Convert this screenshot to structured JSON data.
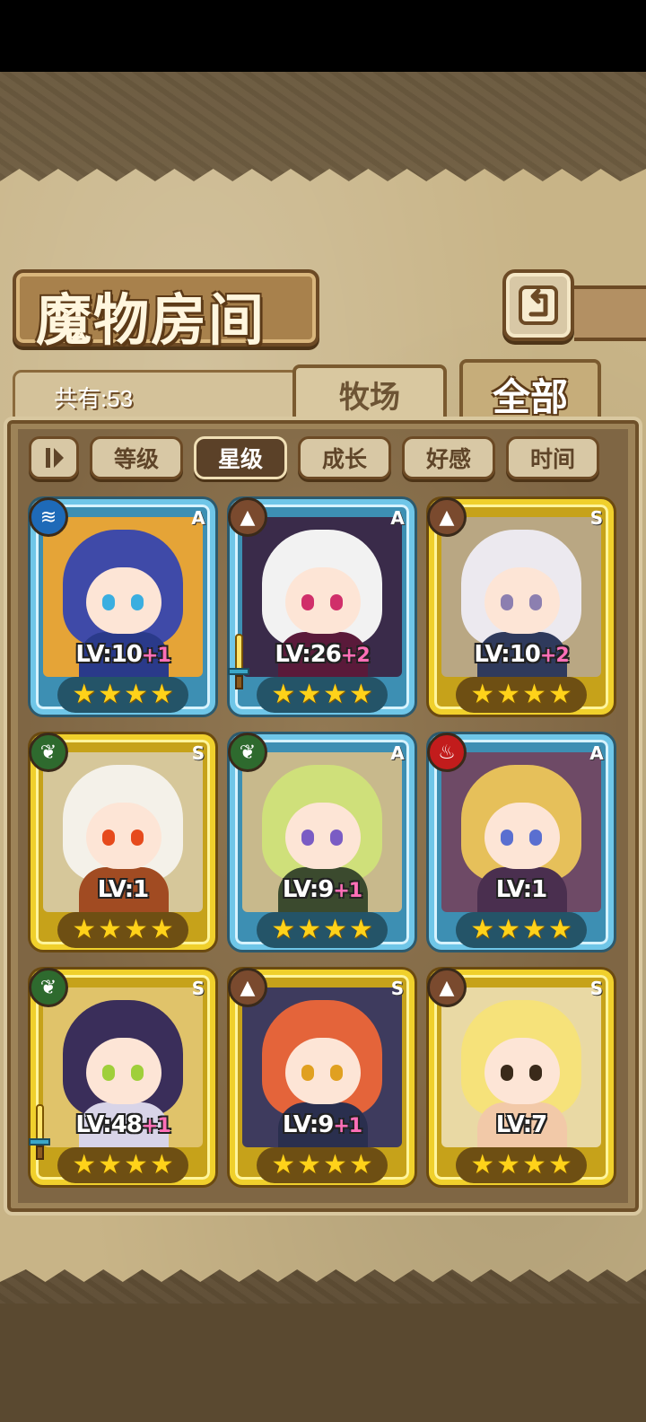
{
  "header": {
    "title": "魔物房间",
    "count_label": "共有:53"
  },
  "tabs": [
    {
      "label": "牧场"
    },
    {
      "label": "全部",
      "active": true
    }
  ],
  "sort_buttons": [
    {
      "label": "等级"
    },
    {
      "label": "星级",
      "active": true
    },
    {
      "label": "成长"
    },
    {
      "label": "好感"
    },
    {
      "label": "时间"
    }
  ],
  "monsters": [
    {
      "rank": "A",
      "element": "water",
      "level": "LV:10",
      "plus": "+1",
      "stars": 4,
      "frame": "blue",
      "weapon": false,
      "hair": "#3f4aa8",
      "body": "#2a3a8a",
      "eye": "#3aaee0",
      "bg": "#e5a437"
    },
    {
      "rank": "A",
      "element": "earth",
      "level": "LV:26",
      "plus": "+2",
      "stars": 4,
      "frame": "blue",
      "weapon": true,
      "hair": "#f2f2f2",
      "body": "#5a1a3a",
      "eye": "#d02f6a",
      "bg": "#3a2b4a"
    },
    {
      "rank": "S",
      "element": "earth",
      "level": "LV:10",
      "plus": "+2",
      "stars": 4,
      "frame": "gold",
      "weapon": false,
      "hair": "#ece9ef",
      "body": "#2f3a5c",
      "eye": "#8c7fb0",
      "bg": "#b9a783"
    },
    {
      "rank": "S",
      "element": "wood",
      "level": "LV:1",
      "plus": "",
      "stars": 4,
      "frame": "gold",
      "weapon": false,
      "hair": "#f4f1e9",
      "body": "#a14b22",
      "eye": "#e64a1c",
      "bg": "#d6c79a"
    },
    {
      "rank": "A",
      "element": "wood",
      "level": "LV:9",
      "plus": "+1",
      "stars": 4,
      "frame": "blue",
      "weapon": false,
      "hair": "#cfe07a",
      "body": "#3b4a2e",
      "eye": "#7a5cc4",
      "bg": "#c8b98c"
    },
    {
      "rank": "A",
      "element": "fire",
      "level": "LV:1",
      "plus": "",
      "stars": 4,
      "frame": "blue",
      "weapon": false,
      "hair": "#e6c05a",
      "body": "#4a2f4f",
      "eye": "#5a6fd0",
      "bg": "#6e4a66"
    },
    {
      "rank": "S",
      "element": "wood",
      "level": "LV:48",
      "plus": "+1",
      "stars": 4,
      "frame": "gold",
      "weapon": true,
      "hair": "#3a2e5a",
      "body": "#d8d4e8",
      "eye": "#9fcf3a",
      "bg": "#e0c36a"
    },
    {
      "rank": "S",
      "element": "earth",
      "level": "LV:9",
      "plus": "+1",
      "stars": 4,
      "frame": "gold",
      "weapon": false,
      "hair": "#e4643a",
      "body": "#2a2f4e",
      "eye": "#e0a020",
      "bg": "#3e3b5e"
    },
    {
      "rank": "S",
      "element": "earth",
      "level": "LV:7",
      "plus": "",
      "stars": 4,
      "frame": "gold",
      "weapon": false,
      "hair": "#f6e27a",
      "body": "#f2c9a8",
      "eye": "#3a2a1a",
      "bg": "#e9d9a4"
    }
  ]
}
